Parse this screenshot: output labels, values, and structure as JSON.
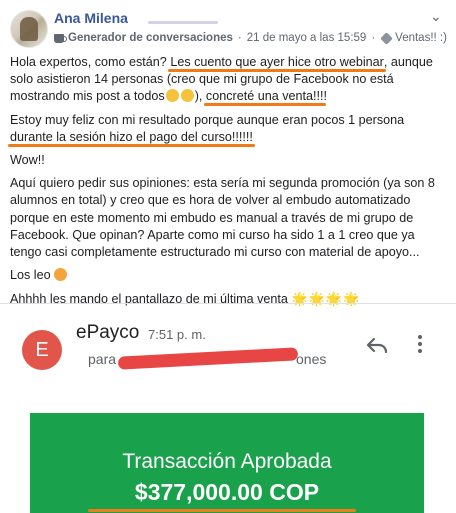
{
  "post": {
    "author": "Ana Milena",
    "group": "Generador de conversaciones",
    "date": "21 de mayo a las 15:59",
    "tag": "Ventas!! :)",
    "separator": "·",
    "chevron": "⌄"
  },
  "body": {
    "p1_a": "Hola expertos, como están? ",
    "p1_b": "Les cuento que ayer hice otro webinar",
    "p1_c": ", aunque solo asistieron 14 personas (creo que mi grupo de Facebook no está mostrando mis post a todos",
    "p1_d": "), ",
    "p1_e": "concreté una venta!!!",
    "p1_f": "!",
    "p2": "Estoy muy feliz con mi resultado porque aunque eran pocos 1 persona durante la sesión hizo el pago del curso!!!!!!",
    "p3": "Wow!!",
    "p4": "Aquí quiero pedir sus opiniones: esta sería mi segunda promoción (ya son 8 alumnos en total) y creo que es hora de volver al embudo automatizado porque en este momento mi embudo es manual a través de mi grupo de Facebook. Que opinan? Aparte como mi curso ha sido 1 a 1 creo que ya tengo casi completamente estructurado mi curso con material de apoyo...",
    "p5": "Los leo ",
    "p6": "Ahhhh les mando el pantallazo de mi última venta ",
    "stars": "🌟🌟🌟🌟"
  },
  "email": {
    "avatar_letter": "E",
    "from": "ePayco",
    "time": "7:51 p. m.",
    "to_prefix": "para",
    "to_suffix": "ones",
    "more": "⋮"
  },
  "receipt": {
    "title": "Transacción Aprobada",
    "amount": "$377,000.00 COP"
  },
  "colors": {
    "brand_link": "#385898",
    "highlight": "#f07b16",
    "approved_green": "#1aa14b",
    "redaction": "#e84545"
  },
  "icons": [
    "group-icon",
    "tag-icon",
    "chevron-down-icon",
    "reply-icon",
    "more-vert-icon"
  ]
}
